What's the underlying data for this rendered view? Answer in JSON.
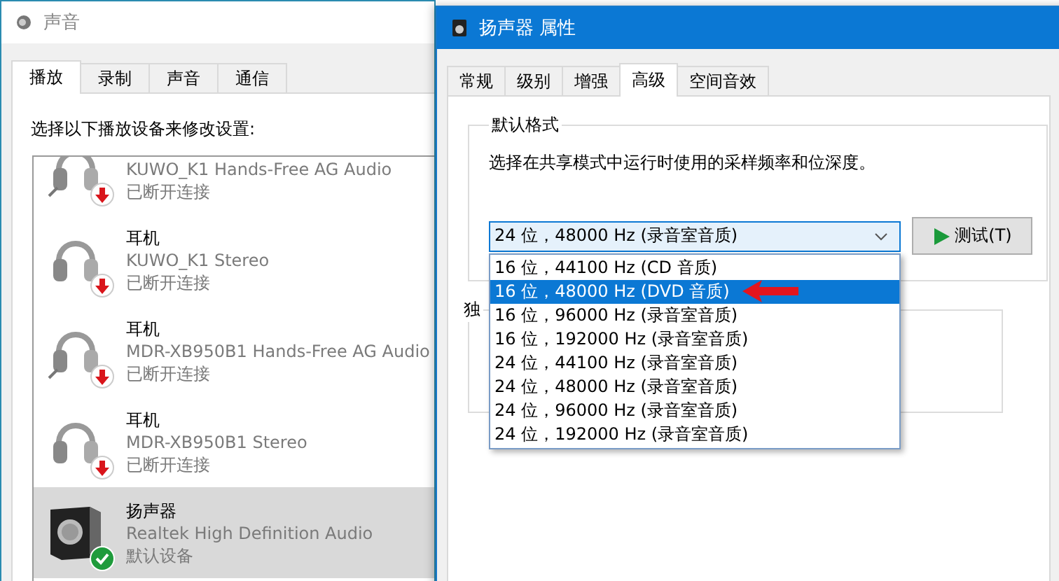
{
  "sound_window": {
    "title": "声音",
    "tabs": [
      {
        "label": "播放",
        "selected": true
      },
      {
        "label": "录制",
        "selected": false
      },
      {
        "label": "声音",
        "selected": false
      },
      {
        "label": "通信",
        "selected": false
      }
    ],
    "prompt": "选择以下播放设备来修改设置:",
    "devices": [
      {
        "kind": "headset",
        "description": "KUWO_K1 Hands-Free AG Audio",
        "status": "已断开连接",
        "connected": false,
        "default": false,
        "selected": false
      },
      {
        "kind": "headphones",
        "name": "耳机",
        "description": "KUWO_K1 Stereo",
        "status": "已断开连接",
        "connected": false,
        "default": false,
        "selected": false
      },
      {
        "kind": "headset",
        "name": "耳机",
        "description": "MDR-XB950B1 Hands-Free AG Audio",
        "status": "已断开连接",
        "connected": false,
        "default": false,
        "selected": false
      },
      {
        "kind": "headphones",
        "name": "耳机",
        "description": "MDR-XB950B1 Stereo",
        "status": "已断开连接",
        "connected": false,
        "default": false,
        "selected": false
      },
      {
        "kind": "speaker",
        "name": "扬声器",
        "description": "Realtek High Definition Audio",
        "status": "默认设备",
        "connected": true,
        "default": true,
        "selected": true
      }
    ]
  },
  "properties_window": {
    "title": "扬声器 属性",
    "tabs": [
      {
        "label": "常规",
        "selected": false
      },
      {
        "label": "级别",
        "selected": false
      },
      {
        "label": "增强",
        "selected": false
      },
      {
        "label": "高级",
        "selected": true
      },
      {
        "label": "空间音效",
        "selected": false
      }
    ],
    "default_format": {
      "label": "默认格式",
      "description": "选择在共享模式中运行时使用的采样频率和位深度。",
      "format_select": {
        "value": "24 位，48000 Hz (录音室音质)",
        "expanded": true,
        "options": [
          {
            "label": "16 位，44100 Hz (CD 音质)",
            "highlighted": false
          },
          {
            "label": "16 位，48000 Hz (DVD 音质)",
            "highlighted": true
          },
          {
            "label": "16 位，96000 Hz (录音室音质)",
            "highlighted": false
          },
          {
            "label": "16 位，192000 Hz (录音室音质)",
            "highlighted": false
          },
          {
            "label": "24 位，44100 Hz (录音室音质)",
            "highlighted": false
          },
          {
            "label": "24 位，48000 Hz (录音室音质)",
            "highlighted": false
          },
          {
            "label": "24 位，96000 Hz (录音室音质)",
            "highlighted": false
          },
          {
            "label": "24 位，192000 Hz (录音室音质)",
            "highlighted": false
          }
        ]
      },
      "test_button": "测试(T)"
    },
    "second_group": {
      "label": "独"
    }
  }
}
